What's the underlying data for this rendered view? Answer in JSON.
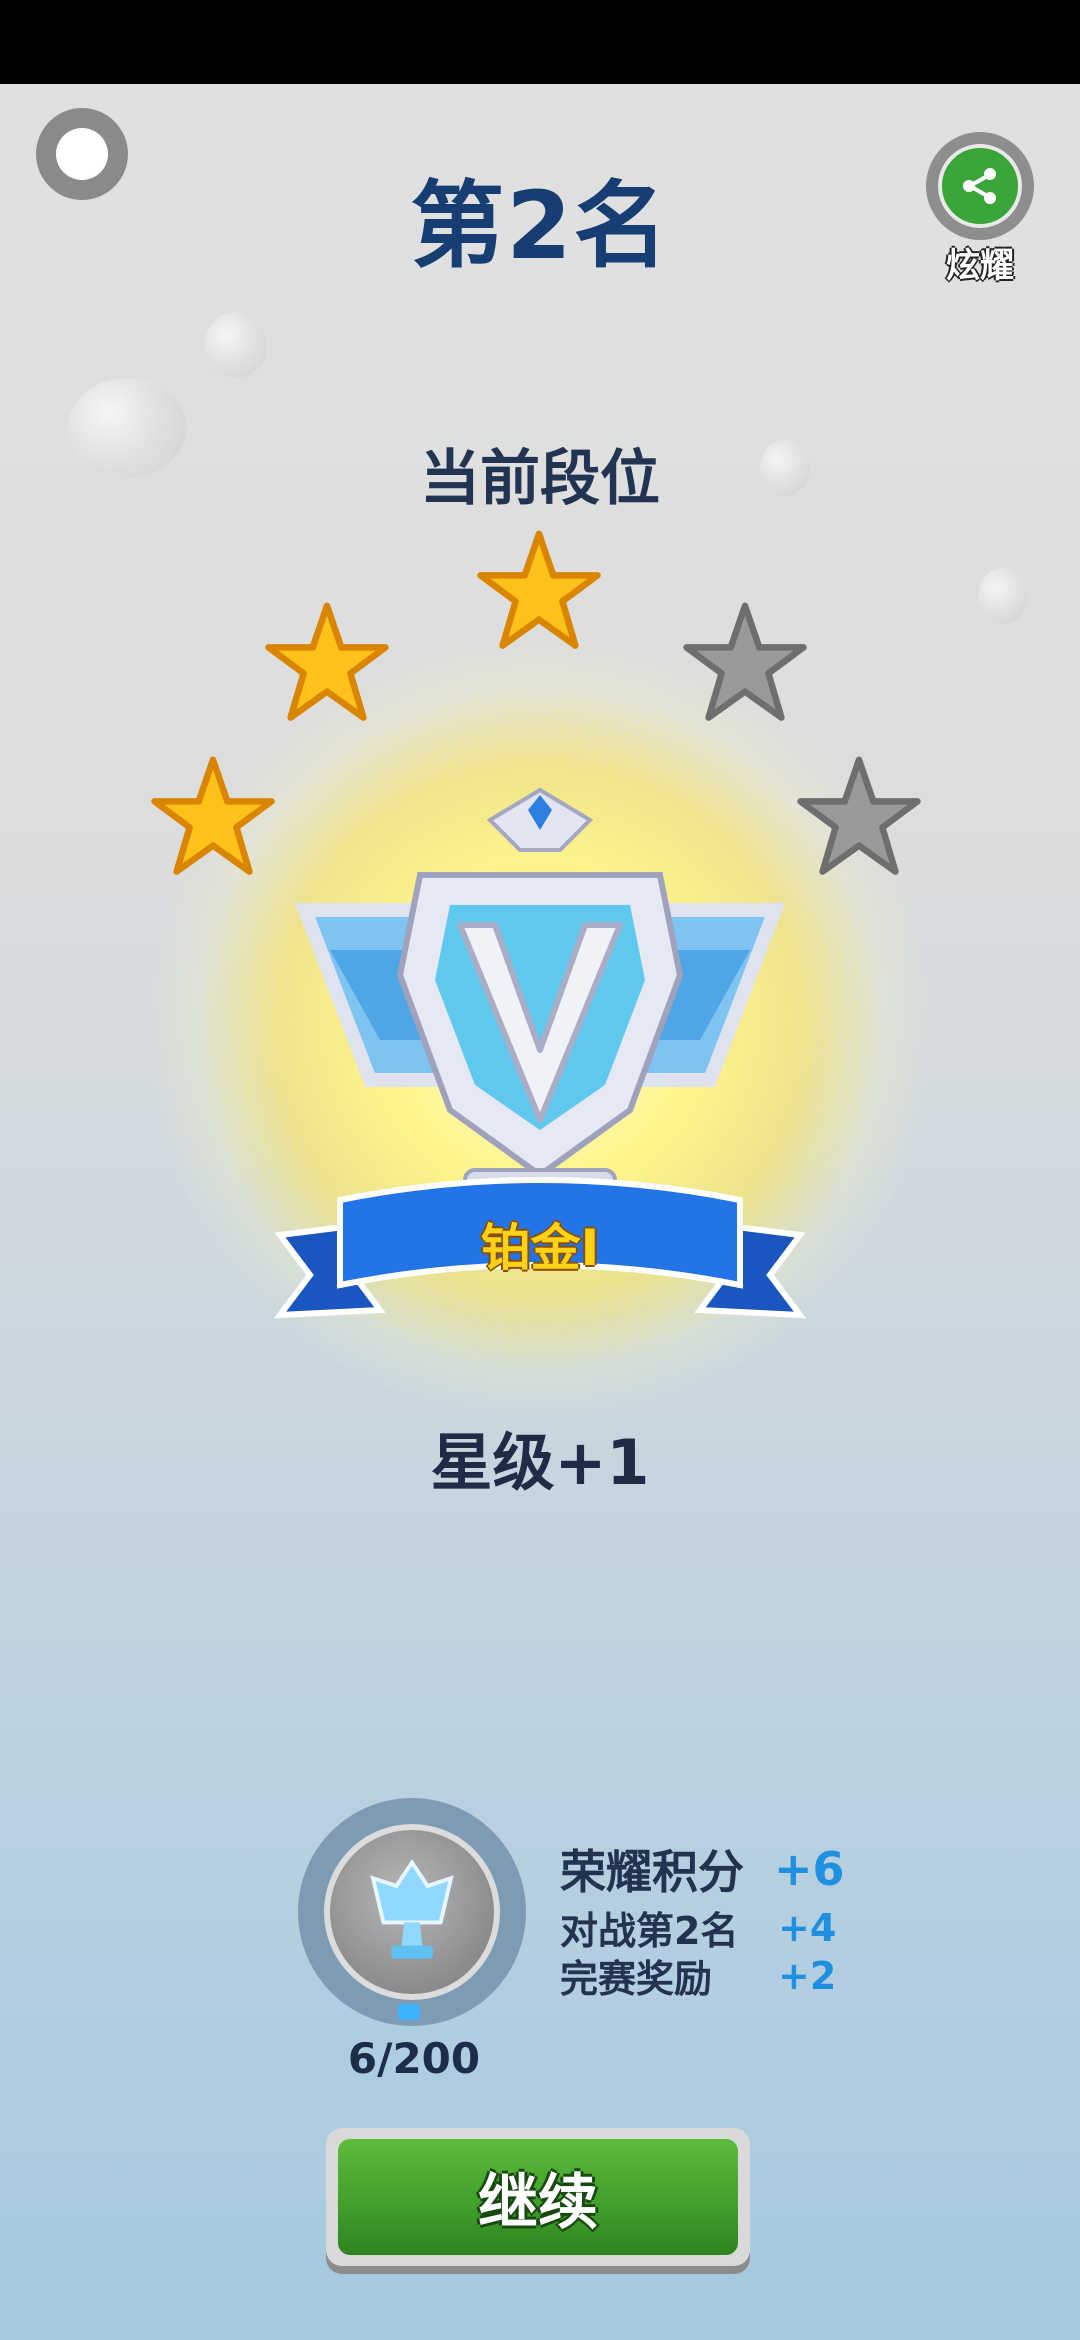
{
  "header": {
    "rank_title": "第2名",
    "share_label": "炫耀"
  },
  "rank": {
    "section_label": "当前段位",
    "tier_name": "铂金I",
    "stars_filled": 3,
    "stars_total": 5,
    "star_change": "星级+1"
  },
  "honor": {
    "progress": "6/200",
    "rows": [
      {
        "label": "荣耀积分",
        "value": "+6"
      },
      {
        "label": "对战第2名",
        "value": "+4"
      },
      {
        "label": "完赛奖励",
        "value": "+2"
      }
    ]
  },
  "actions": {
    "continue_label": "继续"
  },
  "colors": {
    "title": "#163e73",
    "star_filled": "#ffc21a",
    "star_empty": "#8e8e8e",
    "ribbon": "#1e63d6",
    "button": "#46a72f",
    "score_value": "#1f8fe0"
  }
}
